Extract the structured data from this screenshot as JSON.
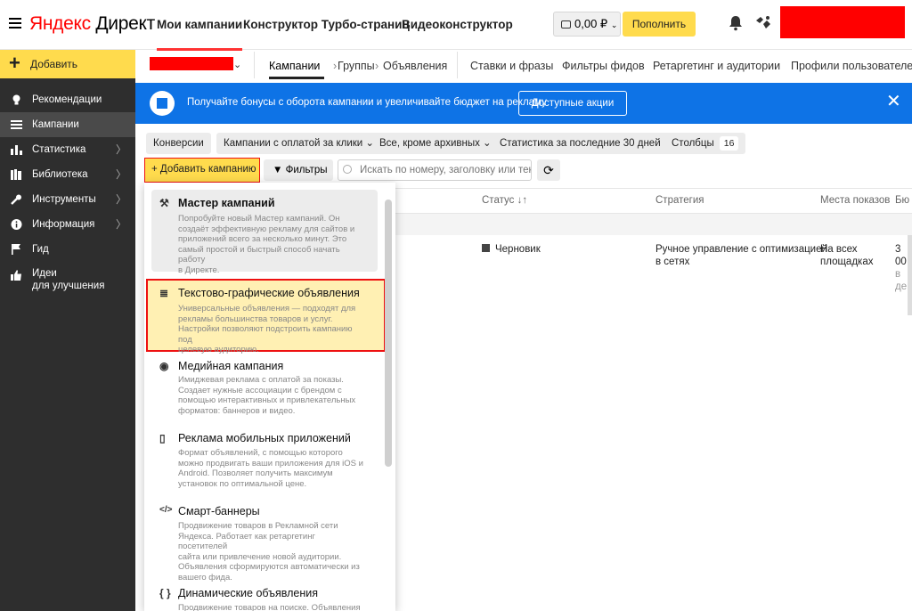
{
  "header": {
    "logo_brand": "Яндекс",
    "logo_product": "Директ",
    "nav": [
      "Мои кампании",
      "Конструктор Турбо-страниц",
      "Видеоконструктор"
    ],
    "balance": "0,00 ₽",
    "topup_label": "Пополнить"
  },
  "sidebar": {
    "add_label": "Добавить",
    "items": [
      {
        "label": "Рекомендации",
        "icon": "lightbulb-icon",
        "chevron": false
      },
      {
        "label": "Кампании",
        "icon": "list-icon",
        "chevron": false,
        "active": true
      },
      {
        "label": "Статистика",
        "icon": "chart-icon",
        "chevron": true
      },
      {
        "label": "Библиотека",
        "icon": "library-icon",
        "chevron": true
      },
      {
        "label": "Инструменты",
        "icon": "wrench-icon",
        "chevron": true
      },
      {
        "label": "Информация",
        "icon": "info-icon",
        "chevron": true
      },
      {
        "label": "Гид",
        "icon": "flag-icon",
        "chevron": false
      },
      {
        "label_line1": "Идеи",
        "label_line2": "для улучшения",
        "icon": "thumbs-up-icon",
        "chevron": false
      }
    ]
  },
  "subnav": {
    "crumbs": [
      "Кампании",
      "Группы",
      "Объявления"
    ],
    "tabs": [
      "Ставки и фразы",
      "Фильтры фидов",
      "Ретаргетинг и аудитории",
      "Профили пользователей"
    ]
  },
  "banner": {
    "text": "Получайте бонусы с оборота кампании и увеличивайте бюджет на рекламу",
    "button": "Доступные акции"
  },
  "filters": {
    "chips": [
      "Конверсии",
      "Кампании с оплатой за клики",
      "Все, кроме архивных",
      "Статистика за последние 30 дней",
      "Столбцы"
    ],
    "columns_count": "16"
  },
  "toolbar": {
    "add_campaign": "Добавить кампанию",
    "filters": "Фильтры",
    "search_placeholder": "Искать по номеру, заголовку или тексту"
  },
  "table": {
    "headers": [
      "Статус",
      "Стратегия",
      "Места показов",
      "Бю"
    ],
    "row": {
      "status": "Черновик",
      "strategy_line1": "Ручное управление с оптимизацией",
      "strategy_line2": "в сетях",
      "places_line1": "На всех",
      "places_line2": "площадках",
      "budget_line1": "3 00",
      "budget_line2": "в де"
    }
  },
  "dropdown": {
    "items": [
      {
        "title": "Мастер кампаний",
        "icon": "magic-wand-icon",
        "desc": [
          "Попробуйте новый Мастер кампаний. Он",
          "создаёт эффективную рекламу для сайтов и",
          "приложений всего за несколько минут. Это",
          "самый простой и быстрый способ начать работу",
          "в Директе."
        ]
      },
      {
        "title": "Текстово-графические объявления",
        "icon": "text-image-icon",
        "desc": [
          "Универсальные объявления — подходят для",
          "рекламы большинства товаров и услуг.",
          "Настройки позволяют подстроить кампанию под",
          "целевую аудиторию."
        ]
      },
      {
        "title": "Медийная кампания",
        "icon": "eye-icon",
        "desc": [
          "Имиджевая реклама с оплатой за показы.",
          "Создает нужные ассоциации с брендом с",
          "помощью интерактивных и привлекательных",
          "форматов: баннеров и видео."
        ]
      },
      {
        "title": "Реклама мобильных приложений",
        "icon": "mobile-icon",
        "desc": [
          "Формат объявлений, с помощью которого",
          "можно продвигать ваши приложения для iOS и",
          "Android. Позволяет получить максимум",
          "установок по оптимальной цене."
        ]
      },
      {
        "title": "Смарт-баннеры",
        "icon": "code-icon",
        "desc": [
          "Продвижение товаров в Рекламной сети",
          "Яндекса. Работает как ретаргетинг посетителей",
          "сайта или привлечение новой аудитории.",
          "Объявления сформируются автоматически из",
          "вашего фида."
        ]
      },
      {
        "title": "Динамические объявления",
        "icon": "braces-icon",
        "desc": [
          "Продвижение товаров на поиске. Объявления и"
        ]
      }
    ]
  }
}
